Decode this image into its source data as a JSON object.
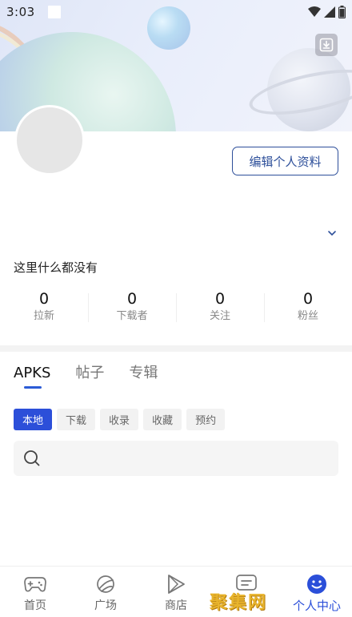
{
  "status_bar": {
    "time": "3:03"
  },
  "profile": {
    "edit_button": "编辑个人资料",
    "empty_text": "这里什么都没有"
  },
  "stats": [
    {
      "value": "0",
      "label": "拉新"
    },
    {
      "value": "0",
      "label": "下载者"
    },
    {
      "value": "0",
      "label": "关注"
    },
    {
      "value": "0",
      "label": "粉丝"
    }
  ],
  "tabs": [
    {
      "label": "APKS",
      "active": true
    },
    {
      "label": "帖子",
      "active": false
    },
    {
      "label": "专辑",
      "active": false
    }
  ],
  "filters": [
    {
      "label": "本地",
      "active": true
    },
    {
      "label": "下载",
      "active": false
    },
    {
      "label": "收录",
      "active": false
    },
    {
      "label": "收藏",
      "active": false
    },
    {
      "label": "预约",
      "active": false
    }
  ],
  "search": {
    "value": "",
    "placeholder": ""
  },
  "bottom_nav": [
    {
      "label": "首页",
      "icon": "gamepad-icon",
      "active": false
    },
    {
      "label": "广场",
      "icon": "planet-icon",
      "active": false
    },
    {
      "label": "商店",
      "icon": "play-icon",
      "active": false
    },
    {
      "label": "",
      "icon": "message-icon",
      "active": false
    },
    {
      "label": "个人中心",
      "icon": "smiley-icon",
      "active": true
    }
  ],
  "watermark": "聚集网",
  "colors": {
    "accent": "#2b4fd9",
    "edit_border": "#2d4f9a"
  }
}
